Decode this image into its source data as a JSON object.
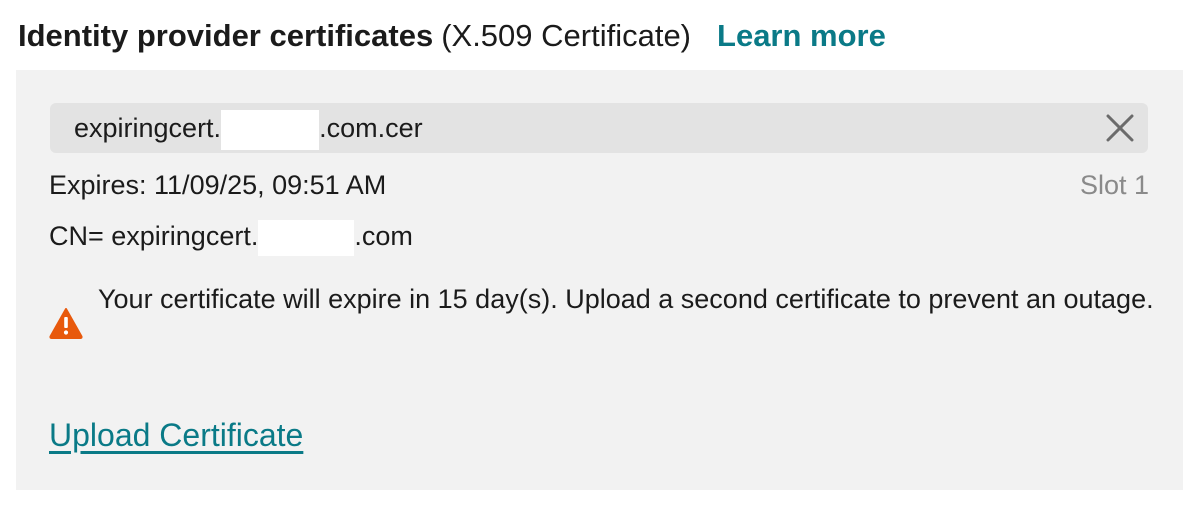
{
  "header": {
    "title_bold": "Identity provider certificates",
    "title_suffix": "(X.509 Certificate)",
    "learn_more": "Learn more"
  },
  "certificate": {
    "file_name_prefix": "expiringcert.",
    "file_name_suffix": ".com.cer",
    "expires": "Expires: 11/09/25, 09:51 AM",
    "slot": "Slot 1",
    "cn_prefix": "CN= expiringcert.",
    "cn_suffix": ".com",
    "warning": "Your certificate will expire in 15 day(s). Upload a second certificate to prevent an outage.",
    "warning_icon": "warning-triangle-icon",
    "remove_icon": "close-icon"
  },
  "actions": {
    "upload": "Upload Certificate"
  },
  "colors": {
    "accent": "#0a7a87",
    "warning": "#e8590c",
    "panel_bg": "#f2f2f2",
    "field_bg": "#e3e3e3",
    "muted_text": "#8a8a8a"
  }
}
